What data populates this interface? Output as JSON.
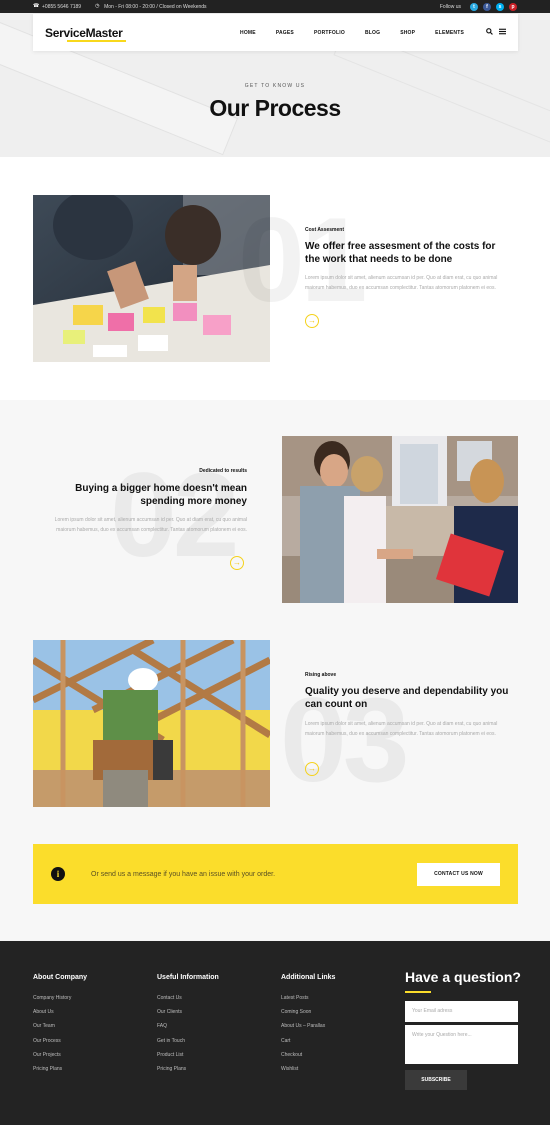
{
  "topbar": {
    "phone": "+0855 5646 7189",
    "hours": "Mon - Fri 08:00 - 20:00 / Closed on Weekends",
    "follow": "Follow us",
    "social": [
      {
        "name": "twitter",
        "glyph": "t",
        "color": "#29a9e1"
      },
      {
        "name": "facebook",
        "glyph": "f",
        "color": "#3b5998"
      },
      {
        "name": "skype",
        "glyph": "s",
        "color": "#00aff0"
      },
      {
        "name": "pinterest",
        "glyph": "p",
        "color": "#cb2027"
      }
    ]
  },
  "header": {
    "logo": "ServiceMaster",
    "menu": [
      "HOME",
      "PAGES",
      "PORTFOLIO",
      "BLOG",
      "SHOP",
      "ELEMENTS"
    ]
  },
  "hero": {
    "kicker": "GET TO KNOW US",
    "title": "Our Process"
  },
  "steps": [
    {
      "number": "01",
      "subtitle": "Cost Assesment",
      "heading": "We offer free assesment of the costs for the work that needs to be done",
      "text": "Lorem ipsum dolor sit amet, alienum accumsan id per. Quo at diam erat, cu quo animal maiorum habemus, duo ex accumsan complectitur. Tantas atomorum platonem ei eos."
    },
    {
      "number": "02",
      "subtitle": "Dedicated to results",
      "heading": "Buying a bigger home doesn't mean spending more money",
      "text": "Lorem ipsum dolor sit amet, alienum accumsan id per. Quo at diam erat, cu quo animal maiorum habemus, duo ex accumsan complectitur. Tantas atomorum platonem ei eos."
    },
    {
      "number": "03",
      "subtitle": "Rising above",
      "heading": "Quality you deserve and dependability you can count on",
      "text": "Lorem ipsum dolor sit amet, alienum accumsan id per. Quo at diam erat, cu quo animal maiorum habemus, duo ex accumsan complectitur. Tantas atomorum platonem ei eos."
    }
  ],
  "cta": {
    "message": "Or send us a message if you have an issue with your order.",
    "button": "CONTACT US NOW"
  },
  "footer": {
    "col1": {
      "title": "About Company",
      "links": [
        "Company History",
        "About Us",
        "Our Team",
        "Our Process",
        "Our Projects",
        "Pricing Plans"
      ]
    },
    "col2": {
      "title": "Useful Information",
      "links": [
        "Contact Us",
        "Our Clients",
        "FAQ",
        "Get in Touch",
        "Product List",
        "Pricing Plans"
      ]
    },
    "col3": {
      "title": "Additional Links",
      "links": [
        "Latest Posts",
        "Coming Soon",
        "About Us – Parallax",
        "Cart",
        "Checkout",
        "Wishlist"
      ]
    },
    "question": {
      "title": "Have a question?",
      "email_placeholder": "Your Email adress",
      "message_placeholder": "Write your Question here...",
      "button": "SUBSCRIBE"
    }
  },
  "colors": {
    "accent": "#fbdd2b",
    "dark": "#232323"
  }
}
